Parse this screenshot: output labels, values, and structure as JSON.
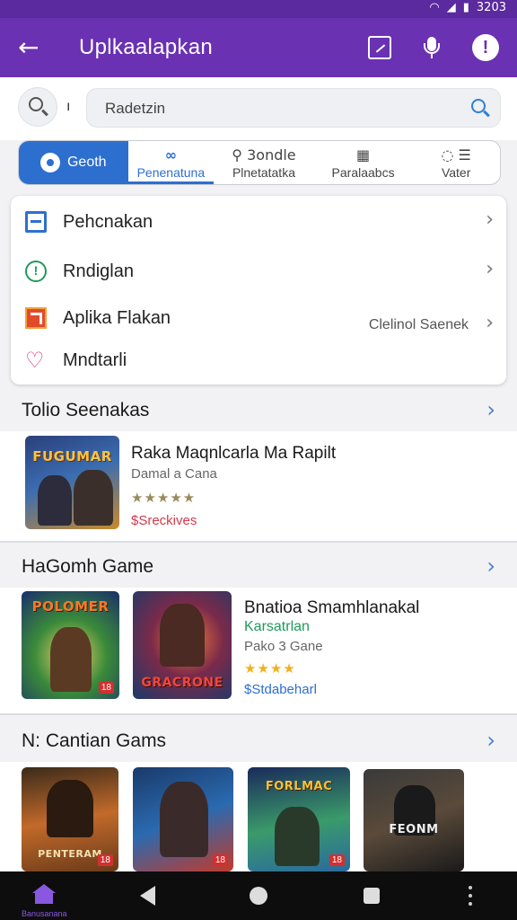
{
  "statusbar": {
    "time": "3203"
  },
  "appbar": {
    "title": "Uplkaalapkan"
  },
  "search": {
    "cursor": "ı",
    "placeholder": "Radetzin"
  },
  "tabs": [
    {
      "label": "Geoth",
      "icon": "gear-icon"
    },
    {
      "label": "Penenatuna",
      "icon": "infinity-icon"
    },
    {
      "label": "Plnetatatka",
      "icon": "location-pin-icon",
      "top": "3ondle"
    },
    {
      "label": "Paralaabcs",
      "icon": "grid-icon"
    },
    {
      "label": "Vater",
      "icon": "chat-filter-icon"
    }
  ],
  "menu": {
    "items": [
      {
        "label": "Pehcnakan",
        "icon": "card-icon",
        "right": ""
      },
      {
        "label": "Rndiglan",
        "icon": "alert-circle-icon",
        "right": ""
      },
      {
        "label": "Aplika Flakan",
        "icon": "tile-icon",
        "right": "Clelinol Saenek"
      },
      {
        "label": "Mndtarli",
        "icon": "heart-icon",
        "right": ""
      }
    ]
  },
  "section1": {
    "title": "Tolio Seenakas",
    "app": {
      "art_caption": "FUGUMAR",
      "title": "Raka Maqnlcarla Ma Rapilt",
      "sub": "Damal a Cana",
      "stars": "★★★★★",
      "price": "$Sreckives"
    }
  },
  "section2": {
    "title": "HaGomh Game",
    "art1_caption": "POLOMER",
    "art2_caption": "GRACRONE",
    "app": {
      "title": "Bnatioa Smamhlanakal",
      "tag": "Karsatrlan",
      "sub": "Pako 3 Gane",
      "stars": "★★★★",
      "price": "$Stdabeharl"
    }
  },
  "section3": {
    "title": "N: Cantian Gams",
    "arts": [
      {
        "caption": "PENTERAM"
      },
      {
        "caption": ""
      },
      {
        "caption": "FORLMAC"
      },
      {
        "caption": "FEONM"
      }
    ]
  },
  "navbar": {
    "home_label": "Banusanana"
  },
  "colors": {
    "appbar": "#6a31b3",
    "accent": "#2d6fcf",
    "price": "#d33a4a",
    "tag": "#1f9a5a"
  }
}
